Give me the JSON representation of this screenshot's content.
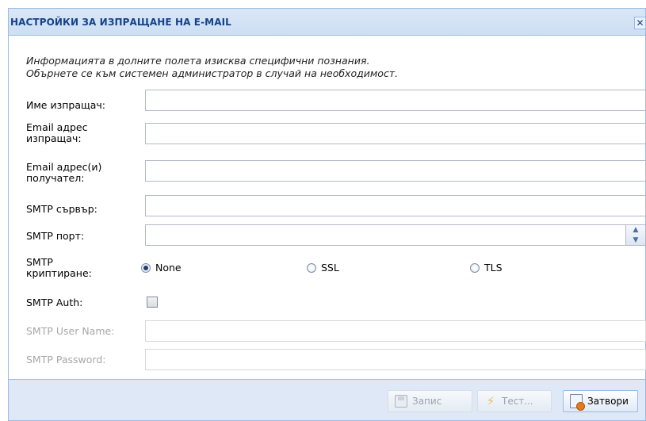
{
  "window": {
    "title": "НАСТРОЙКИ ЗА ИЗПРАЩАНЕ НА E-MAIL",
    "close_glyph": "✕"
  },
  "info": {
    "line1": "Информацията в долните полета изисква специфични познания.",
    "line2": "Обърнете се към системен администратор в случай на необходимост."
  },
  "form": {
    "sender_name": {
      "label": "Име изпращач:",
      "value": ""
    },
    "sender_email": {
      "label_line1": "Email адрес",
      "label_line2": "изпращач:",
      "value": ""
    },
    "recipient_email": {
      "label_line1": "Email адрес(и)",
      "label_line2": "получател:",
      "value": ""
    },
    "smtp_server": {
      "label": "SMTP сървър:",
      "value": ""
    },
    "smtp_port": {
      "label": "SMTP порт:",
      "value": ""
    },
    "smtp_encryption": {
      "label_line1": "SMTP",
      "label_line2": "криптиране:",
      "options": [
        "None",
        "SSL",
        "TLS"
      ],
      "selected": "None"
    },
    "smtp_auth": {
      "label": "SMTP Auth:",
      "checked": false
    },
    "smtp_user": {
      "label": "SMTP User Name:",
      "value": ""
    },
    "smtp_password": {
      "label": "SMTP Password:",
      "value": ""
    }
  },
  "footer": {
    "save_label": "Запис",
    "test_label": "Тест...",
    "close_label": "Затвори"
  },
  "icons": {
    "save": "save-icon",
    "test": "lightning-icon",
    "close": "close-document-icon"
  },
  "colors": {
    "title_text": "#15428b",
    "title_bar": "#d4e3f5",
    "border": "#99bbe8",
    "footer_bg": "#dfe8f6",
    "disabled_text": "#a7a7a7"
  }
}
